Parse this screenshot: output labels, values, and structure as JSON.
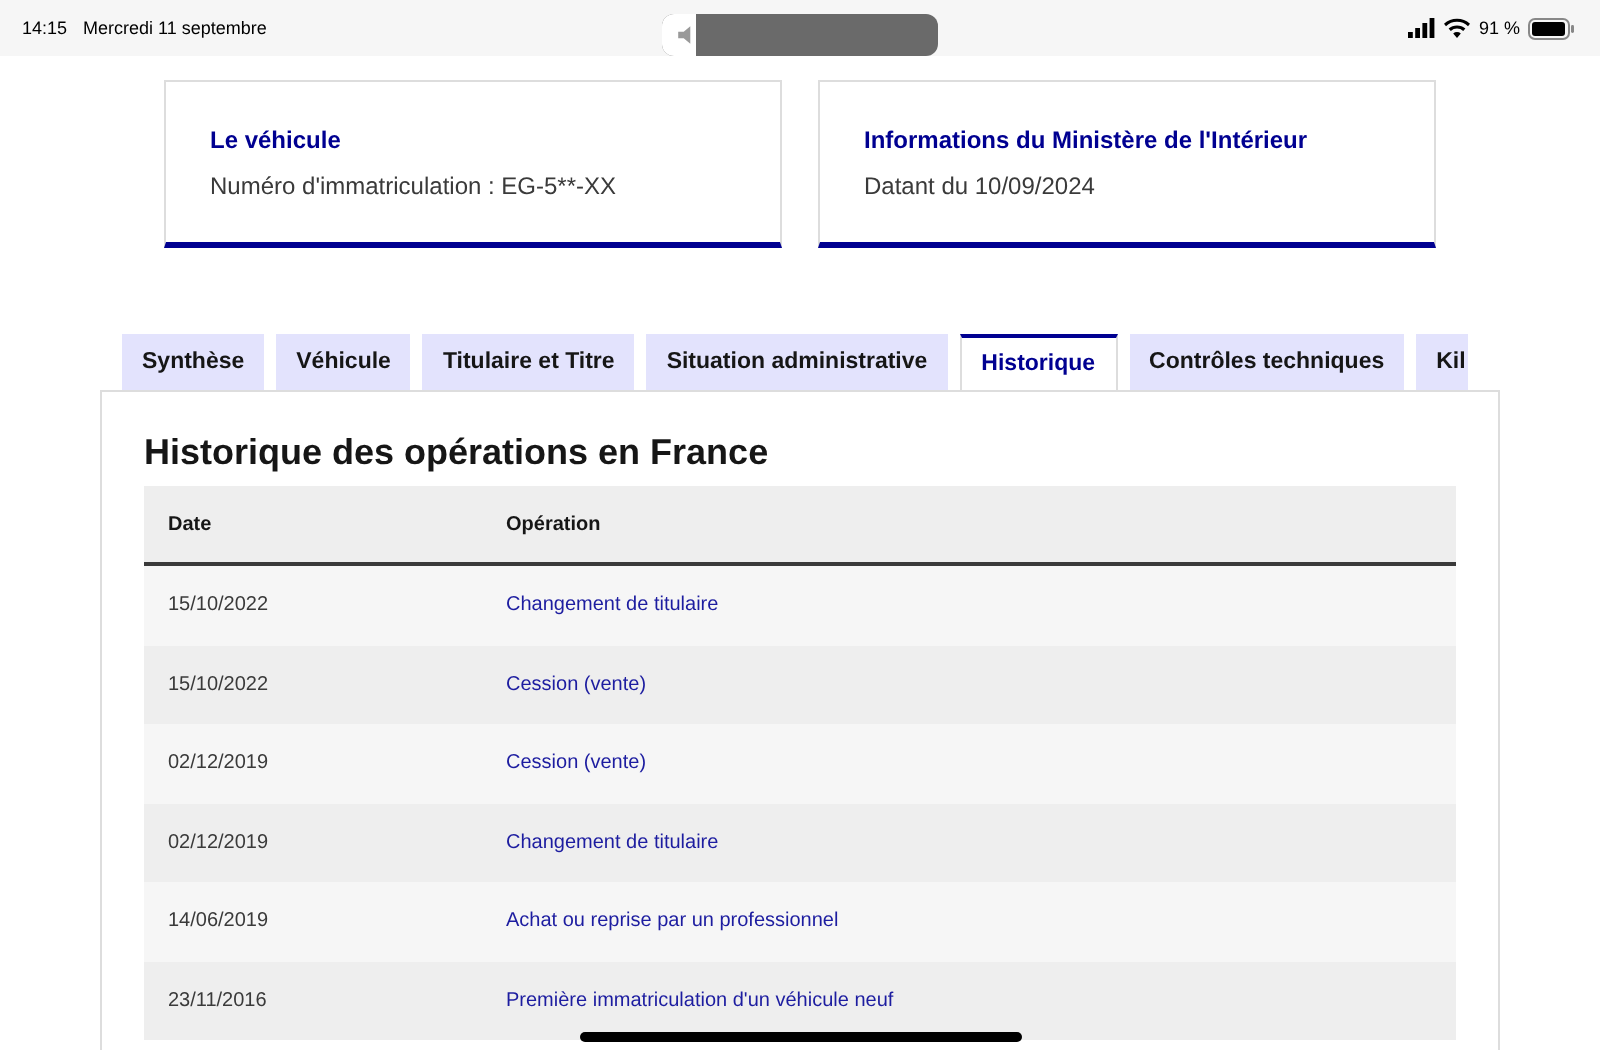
{
  "status_bar": {
    "time": "14:15",
    "date": "Mercredi 11 septembre",
    "volume": {
      "level": 0.12
    },
    "battery": "91 %"
  },
  "cards": [
    {
      "title": "Le véhicule",
      "text": "Numéro d'immatriculation : EG-5**-XX"
    },
    {
      "title": "Informations du Ministère de l'Intérieur",
      "text": "Datant du 10/09/2024"
    }
  ],
  "tabs": [
    {
      "label": "Synthèse",
      "selected": false
    },
    {
      "label": "Véhicule",
      "selected": false
    },
    {
      "label": "Titulaire et Titre",
      "selected": false
    },
    {
      "label": "Situation administrative",
      "selected": false
    },
    {
      "label": "Historique",
      "selected": true
    },
    {
      "label": "Contrôles techniques",
      "selected": false
    },
    {
      "label": "Kil",
      "selected": false
    }
  ],
  "section_title": "Historique des opérations en France",
  "table": {
    "columns": [
      "Date",
      "Opération"
    ],
    "rows": [
      [
        "15/10/2022",
        "Changement de titulaire"
      ],
      [
        "15/10/2022",
        "Cession (vente)"
      ],
      [
        "02/12/2019",
        "Cession (vente)"
      ],
      [
        "02/12/2019",
        "Changement de titulaire"
      ],
      [
        "14/06/2019",
        "Achat ou reprise par un professionnel"
      ],
      [
        "23/11/2016",
        "Première immatriculation d'un véhicule neuf"
      ]
    ]
  }
}
